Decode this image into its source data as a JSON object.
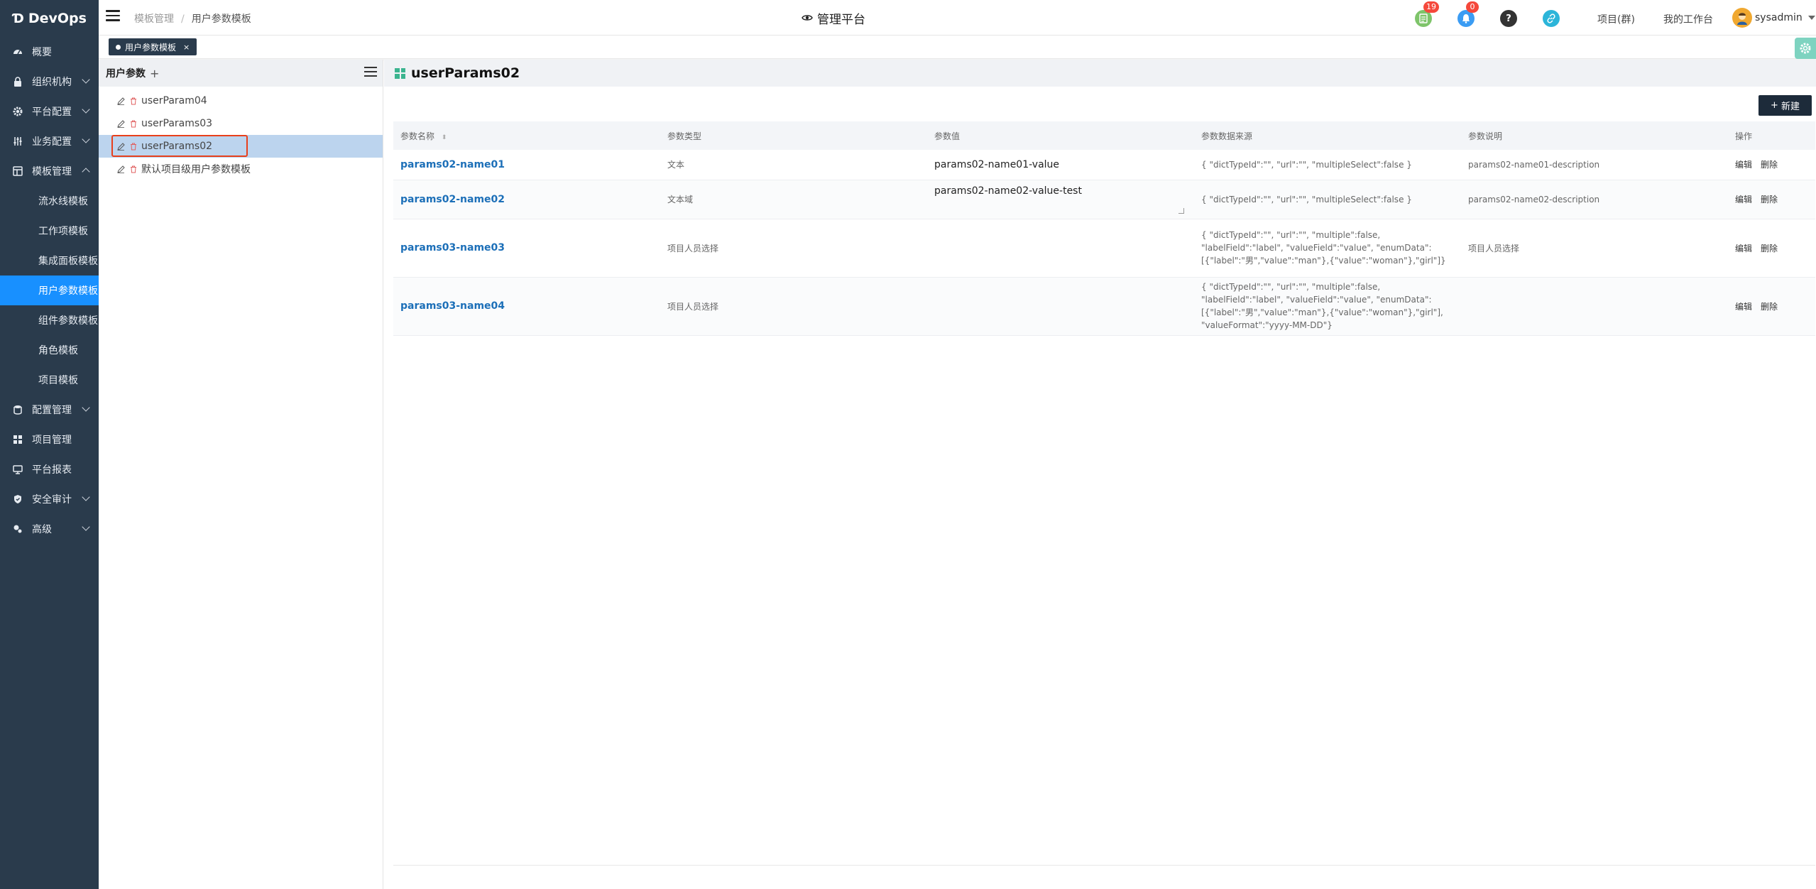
{
  "app": {
    "logo_text": "DevOps"
  },
  "sidebar": {
    "items": [
      {
        "label": "概要"
      },
      {
        "label": "组织机构"
      },
      {
        "label": "平台配置"
      },
      {
        "label": "业务配置"
      },
      {
        "label": "模板管理"
      }
    ],
    "sub_items": [
      {
        "label": "流水线模板"
      },
      {
        "label": "工作项模板"
      },
      {
        "label": "集成面板模板"
      },
      {
        "label": "用户参数模板"
      },
      {
        "label": "组件参数模板"
      },
      {
        "label": "角色模板"
      },
      {
        "label": "项目模板"
      }
    ],
    "items_after": [
      {
        "label": "配置管理"
      },
      {
        "label": "项目管理"
      },
      {
        "label": "平台报表"
      },
      {
        "label": "安全审计"
      },
      {
        "label": "高级"
      }
    ]
  },
  "header": {
    "breadcrumb": [
      "模板管理",
      "用户参数模板"
    ],
    "platform_title": "管理平台",
    "badge_tasks": "19",
    "badge_notices": "0",
    "help_icon": "?",
    "project_group_link": "项目(群)",
    "workspace_link": "我的工作台",
    "username": "sysadmin"
  },
  "tagbar": {
    "tab_label": "用户参数模板",
    "close": "×"
  },
  "tree": {
    "title": "用户参数",
    "add": "+",
    "nodes": [
      {
        "label": "userParam04"
      },
      {
        "label": "userParams03"
      },
      {
        "label": "userParams02"
      },
      {
        "label": "默认项目级用户参数模板"
      }
    ]
  },
  "main": {
    "title": "userParams02",
    "new_button": "新建",
    "new_plus": "+",
    "columns": [
      "参数名称",
      "参数类型",
      "参数值",
      "参数数据来源",
      "参数说明",
      "操作"
    ],
    "rows": [
      {
        "name": "params02-name01",
        "type": "文本",
        "value": "params02-name01-value",
        "source": "{ \"dictTypeId\":\"\", \"url\":\"\", \"multipleSelect\":false }",
        "desc": "params02-name01-description",
        "edit": "编辑",
        "delete": "删除"
      },
      {
        "name": "params02-name02",
        "type": "文本域",
        "value": "params02-name02-value-test",
        "source": "{ \"dictTypeId\":\"\", \"url\":\"\", \"multipleSelect\":false }",
        "desc": "params02-name02-description",
        "edit": "编辑",
        "delete": "删除"
      },
      {
        "name": "params03-name03",
        "type": "项目人员选择",
        "value": "",
        "source": "{ \"dictTypeId\":\"\", \"url\":\"\", \"multiple\":false, \"labelField\":\"label\", \"valueField\":\"value\", \"enumData\":[{\"label\":\"男\",\"value\":\"man\"},{\"value\":\"woman\"},\"girl\"]}",
        "desc": "项目人员选择",
        "edit": "编辑",
        "delete": "删除"
      },
      {
        "name": "params03-name04",
        "type": "项目人员选择",
        "value": "",
        "source": "{ \"dictTypeId\":\"\", \"url\":\"\", \"multiple\":false, \"labelField\":\"label\", \"valueField\":\"value\", \"enumData\":[{\"label\":\"男\",\"value\":\"man\"},{\"value\":\"woman\"},\"girl\"], \"valueFormat\":\"yyyy-MM-DD\"}",
        "desc": "",
        "edit": "编辑",
        "delete": "删除"
      }
    ]
  }
}
